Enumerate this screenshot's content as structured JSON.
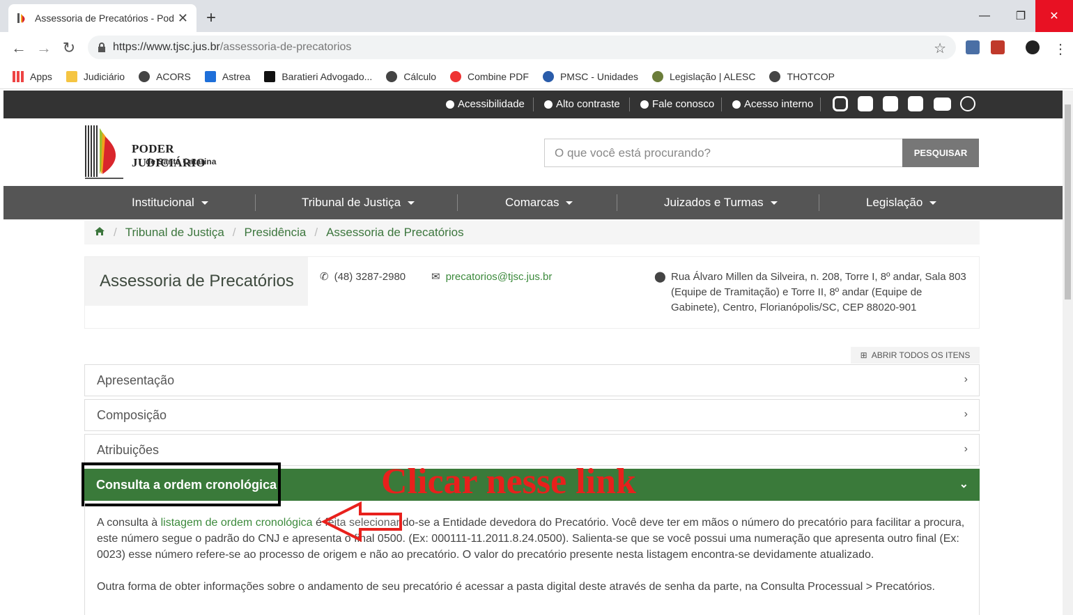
{
  "browser": {
    "tab_title": "Assessoria de Precatórios - Poder",
    "url_host": "https://www.tjsc.jus.br",
    "url_path": "/assessoria-de-precatorios",
    "bookmarks": [
      "Apps",
      "Judiciário",
      "ACORS",
      "Astrea",
      "Baratieri Advogado...",
      "Cálculo",
      "Combine PDF",
      "PMSC - Unidades",
      "Legislação | ALESC",
      "THOTCOP"
    ]
  },
  "topbar": {
    "accessibility": "Acessibilidade",
    "contrast": "Alto contraste",
    "contact": "Fale conosco",
    "internal": "Acesso interno"
  },
  "header": {
    "logo_line1": "PODER JUDICIÁRIO",
    "logo_line2": "de Santa Catarina",
    "search_placeholder": "O que você está procurando?",
    "search_button": "PESQUISAR"
  },
  "nav": [
    "Institucional",
    "Tribunal de Justiça",
    "Comarcas",
    "Juizados e Turmas",
    "Legislação"
  ],
  "breadcrumb": [
    "Tribunal de Justiça",
    "Presidência",
    "Assessoria de Precatórios"
  ],
  "info": {
    "title": "Assessoria de Precatórios",
    "phone": "(48) 3287-2980",
    "email": "precatorios@tjsc.jus.br",
    "address_1": "Rua Álvaro Millen da Silveira, n. 208, Torre I, 8º andar, Sala 803",
    "address_2": "(Equipe de Tramitação) e Torre II, 8º andar (Equipe de",
    "address_3": "Gabinete), Centro, Florianópolis/SC, CEP 88020-901"
  },
  "expand_all": "ABRIR TODOS OS ITENS",
  "accordion": [
    "Apresentação",
    "Composição",
    "Atribuições"
  ],
  "active_item": "Consulta a ordem cronológica",
  "annotation": "Clicar nesse link",
  "body": {
    "p1_before": "A consulta à ",
    "p1_link": "listagem de ordem cronológica",
    "p1_after": " é feita selecionando-se a Entidade devedora do Precatório. Você deve ter em mãos o número do precatório para facilitar a procura, este número segue o padrão do CNJ e apresenta o final 0500. (Ex: 000111-11.2011.8.24.0500). Salienta-se que se você possui uma numeração que apresenta outro final (Ex: 0023) esse número refere-se ao processo de origem e não ao precatório. O valor do precatório presente nesta listagem encontra-se devidamente atualizado.",
    "p2": "Outra forma de obter informações sobre o andamento de seu precatório é acessar a pasta digital deste através de senha da parte, na Consulta Processual > Precatórios."
  },
  "colors": {
    "green": "#3a7a3a",
    "annotation_red": "#e8201c",
    "dark": "#333333",
    "nav": "#555555"
  }
}
